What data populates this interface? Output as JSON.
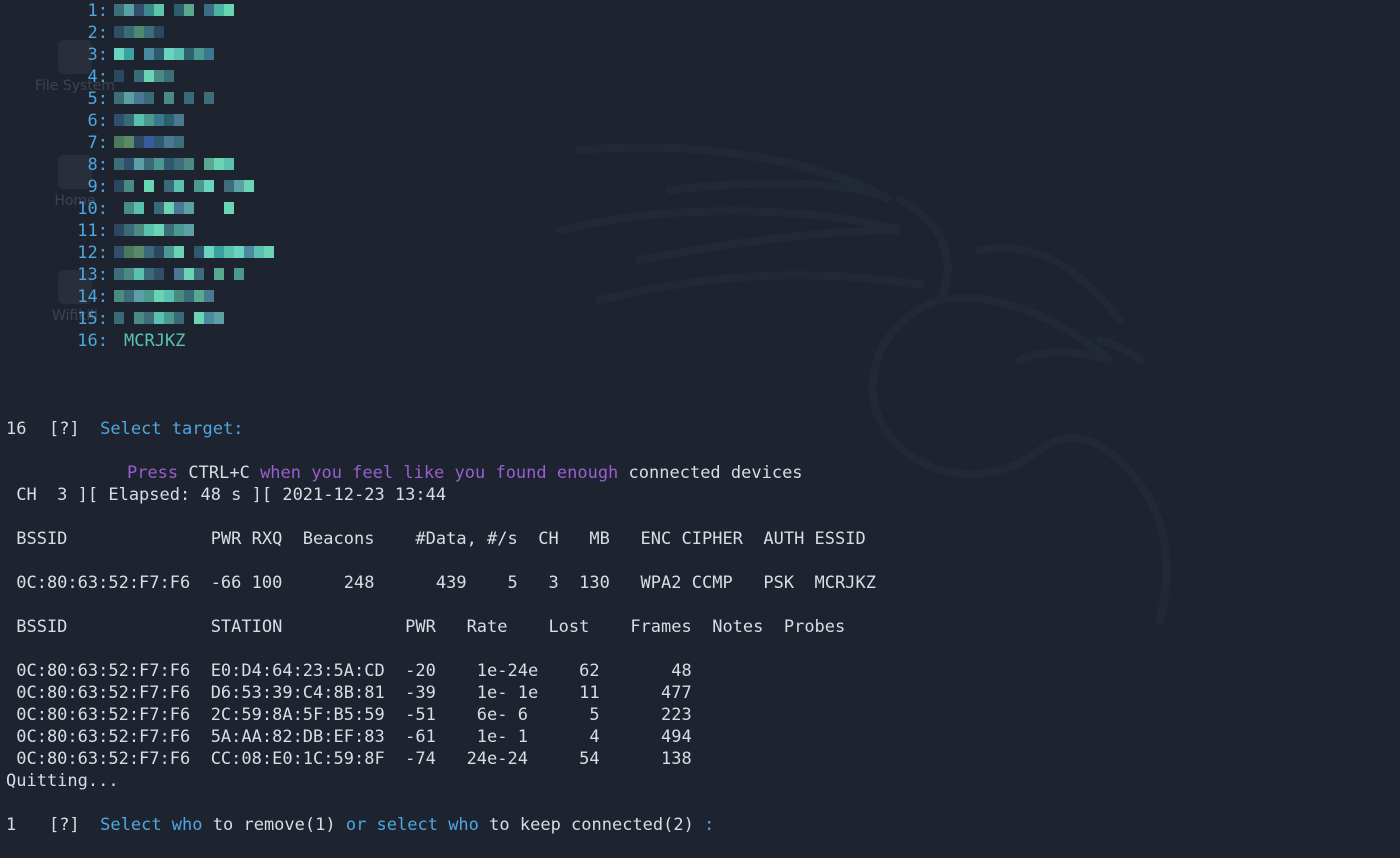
{
  "networks": [
    {
      "num": "1:",
      "pix": [
        "#3c6e7a",
        "#5aa0a4",
        "#2f4f6a",
        "#3a8a8c",
        "#5ec4aa",
        "#1d2430",
        "#2c5f6e",
        "#5aa890",
        "#1d2430",
        "#3b6c84",
        "#48b3a0",
        "#6ad4b4"
      ]
    },
    {
      "num": "2:",
      "pix": [
        "#2b4f63",
        "#3a6a78",
        "#4d8a6e",
        "#3c6e7a",
        "#2c4860"
      ]
    },
    {
      "num": "3:",
      "pix": [
        "#6ad4c0",
        "#3aa0a0",
        "#1d2430",
        "#4a8aa0",
        "#2e5a70",
        "#6ad4c0",
        "#5ac0b0",
        "#2f6070",
        "#4a9890",
        "#3a7890"
      ]
    },
    {
      "num": "4:",
      "pix": [
        "#2c4860",
        "#1d2430",
        "#3a6a78",
        "#6ad4b4",
        "#4a8a80",
        "#3c6e7a"
      ]
    },
    {
      "num": "5:",
      "pix": [
        "#3c6e7a",
        "#5aa0a4",
        "#4a7890",
        "#3a6a78",
        "#1d2430",
        "#4a8a80",
        "#1d2430",
        "#3a6a78",
        "#1d2430",
        "#3c6e7a"
      ]
    },
    {
      "num": "6:",
      "pix": [
        "#2f4f6a",
        "#3a6a78",
        "#5ac0b0",
        "#4a9890",
        "#3a7890",
        "#2c5f6e",
        "#4a7890"
      ]
    },
    {
      "num": "7:",
      "pix": [
        "#4a7a5a",
        "#5a8a6a",
        "#2c4860",
        "#3a5aa0",
        "#2e5a70",
        "#4a7890",
        "#3c6e7a"
      ]
    },
    {
      "num": "8:",
      "pix": [
        "#3c6e7a",
        "#2f4f6a",
        "#5aa0a4",
        "#3a6a78",
        "#4a9890",
        "#2e5a70",
        "#3c6e7a",
        "#4a8a80",
        "#1d2430",
        "#5aa890",
        "#6ad4b4",
        "#5ac0b0"
      ]
    },
    {
      "num": "9:",
      "pix": [
        "#2c4860",
        "#4a8a80",
        "#1d2430",
        "#6ad4b4",
        "#1d2430",
        "#3a6a78",
        "#5ac0b0",
        "#1d2430",
        "#4a9890",
        "#6ad4c0",
        "#1d2430",
        "#3c6e7a",
        "#5aa0a4",
        "#6ad4b4"
      ]
    },
    {
      "num": "10:",
      "pix": [
        "#1d2430",
        "#4a8a80",
        "#5ac0b0",
        "#1d2430",
        "#3a6a78",
        "#6ad4b4",
        "#4a7890",
        "#5aa0a4",
        "#1d2430",
        "#1d2430",
        "#1d2430",
        "#6ad4b4"
      ]
    },
    {
      "num": "11:",
      "pix": [
        "#2c4860",
        "#3a6a78",
        "#4a8a80",
        "#5ac0b0",
        "#6ad4b4",
        "#3c6e7a",
        "#4a9890",
        "#5aa0a4"
      ]
    },
    {
      "num": "12:",
      "pix": [
        "#2f4f6a",
        "#4a7a5a",
        "#5a8a6a",
        "#3a6a78",
        "#2c4860",
        "#4a9890",
        "#6ad4b4",
        "#1d2430",
        "#2e5a70",
        "#6ad4c0",
        "#3aa0a0",
        "#5ac0b0",
        "#6ad4c0",
        "#4a8aa0",
        "#5ac0b0",
        "#6ad4b4"
      ]
    },
    {
      "num": "13:",
      "pix": [
        "#3c6e7a",
        "#4a8a80",
        "#5ac0b0",
        "#3a6a78",
        "#2f4f6a",
        "#1d2430",
        "#4a7890",
        "#6ad4b4",
        "#3c6e7a",
        "#1d2430",
        "#5aa890",
        "#1d2430",
        "#4a9890"
      ]
    },
    {
      "num": "14:",
      "pix": [
        "#4a8a80",
        "#3c6e7a",
        "#5aa0a4",
        "#4a9890",
        "#6ad4b4",
        "#5ac0b0",
        "#4a8a80",
        "#3a6a78",
        "#5aa890",
        "#4a7890"
      ]
    },
    {
      "num": "15:",
      "pix": [
        "#3a6a78",
        "#1d2430",
        "#4a8a80",
        "#3c6e7a",
        "#5ac0b0",
        "#4a9890",
        "#3a6a78",
        "#1d2430",
        "#6ad4b4",
        "#4a8aa0",
        "#5aa0a4"
      ]
    },
    {
      "num": "16:",
      "name": "MCRJKZ"
    }
  ],
  "prompt1": {
    "bracket": "[?]",
    "text": "Select target:"
  },
  "input1": "16",
  "notice": {
    "press": "Press",
    "keys": "CTRL+C",
    "mid": "when you feel like you found enough",
    "end": "connected devices"
  },
  "status_line": " CH  3 ][ Elapsed: 48 s ][ 2021-12-23 13:44",
  "ap_header": " BSSID              PWR RXQ  Beacons    #Data, #/s  CH   MB   ENC CIPHER  AUTH ESSID",
  "ap_row": " 0C:80:63:52:F7:F6  -66 100      248      439    5   3  130   WPA2 CCMP   PSK  MCRJKZ",
  "station_header": " BSSID              STATION            PWR   Rate    Lost    Frames  Notes  Probes",
  "station_rows": [
    " 0C:80:63:52:F7:F6  E0:D4:64:23:5A:CD  -20    1e-24e    62       48",
    " 0C:80:63:52:F7:F6  D6:53:39:C4:8B:81  -39    1e- 1e    11      477",
    " 0C:80:63:52:F7:F6  2C:59:8A:5F:B5:59  -51    6e- 6      5      223",
    " 0C:80:63:52:F7:F6  5A:AA:82:DB:EF:83  -61    1e- 1      4      494",
    " 0C:80:63:52:F7:F6  CC:08:E0:1C:59:8F  -74   24e-24     54      138"
  ],
  "quitting": "Quitting...",
  "prompt2": {
    "bracket": "[?]",
    "a": "Select who",
    "b": "to remove(1)",
    "c": "or select who",
    "d": "to keep connected(2)",
    "e": ":"
  },
  "input2": "1",
  "desktop_icons": [
    {
      "icon": "filesystem-icon",
      "label": "File System"
    },
    {
      "icon": "home-icon",
      "label": "Home"
    },
    {
      "icon": "folder-icon",
      "label": "Wifikill"
    }
  ]
}
